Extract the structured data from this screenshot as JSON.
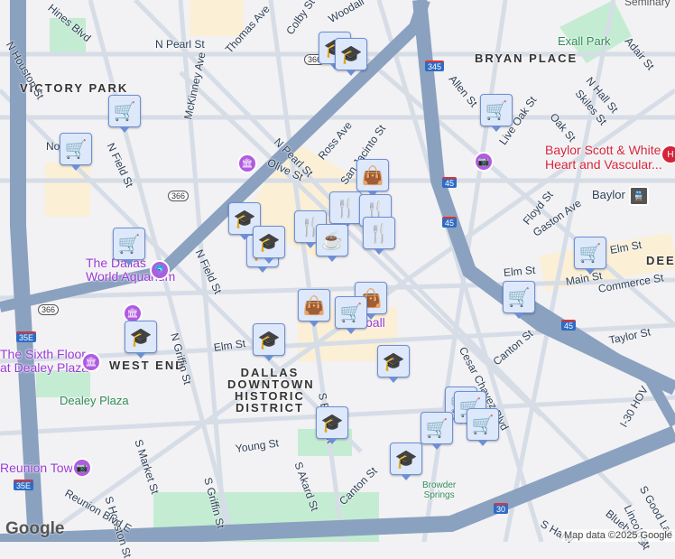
{
  "areas": {
    "victory_park": "VICTORY PARK",
    "bryan_place": "BRYAN PLACE",
    "west_end": "WEST END",
    "historic_1": "DALLAS",
    "historic_2": "DOWNTOWN",
    "historic_3": "HISTORIC",
    "historic_4": "DISTRICT",
    "deep": "DEEP",
    "seminary": "Seminary"
  },
  "parks": {
    "exall": "Exall Park",
    "dealey": "Dealey Plaza",
    "browder_1": "Browder",
    "browder_2": "Springs"
  },
  "pois": {
    "aquarium_1": "The Dallas",
    "aquarium_2": "World Aquarium",
    "sixth_floor_1": "The Sixth Floor",
    "sixth_floor_2": "at Dealey Plaza",
    "reunion": "Reunion Tower",
    "baylor_hosp_1": "Baylor Scott & White",
    "baylor_hosp_2": "Heart and Vascular...",
    "baylor_station": "Baylor",
    "poi_partial": "ball"
  },
  "streets": {
    "woodall": "Woodall",
    "n_pearl_1": "N Pearl St",
    "n_pearl_2": "N Pearl St",
    "thomas": "Thomas Ave",
    "colby": "Colby St",
    "mckinney": "McKinney Ave",
    "n_houston": "N Houston St",
    "n_field_1": "N Field St",
    "n_field_2": "N Field St",
    "olive": "Olive St",
    "ross": "Ross Ave",
    "san_jacinto": "San Jacinto St",
    "allen": "Allen St",
    "live_oak": "Live Oak St",
    "oak": "Oak St",
    "skiles": "Skiles St",
    "n_hall": "N Hall St",
    "adair": "Adair St",
    "floyd": "Floyd St",
    "gaston": "Gaston Ave",
    "elm_1": "Elm St",
    "elm_2": "Elm St",
    "elm_3": "Elm St",
    "main": "Main St",
    "commerce": "Commerce St",
    "taylor": "Taylor St",
    "canton_1": "Canton St",
    "canton_2": "Canton St",
    "cesar_chavez": "Cesar Chavez Blvd",
    "young": "Young St",
    "s_akard": "S Akard St",
    "s_ervay": "S Ervay St",
    "s_griffin": "S Griffin St",
    "n_griffin": "N Griffin St",
    "s_market": "S Market St",
    "s_houston": "S Houston St",
    "reunion_blvd": "Reunion Blvd E",
    "s_good_latimer": "S Good Lat",
    "lincoln": "Lincoln St",
    "bluebell": "Bluebell St",
    "s_harwood": "S Harw",
    "i30_hov": "I-30 HOV",
    "hines": "Hines Blvd",
    "north_partial": "No"
  },
  "shields": {
    "i345": "345",
    "i45_a": "45",
    "i45_b": "45",
    "i45_c": "45",
    "i35e_a": "35E",
    "i35e_b": "35E",
    "i30": "30",
    "sr366_a": "366",
    "sr366_b": "366",
    "sr366_c": "366"
  },
  "markers": [
    {
      "type": "education"
    },
    {
      "type": "education"
    },
    {
      "type": "grocery"
    },
    {
      "type": "grocery"
    },
    {
      "type": "grocery"
    },
    {
      "type": "shopping"
    },
    {
      "type": "education"
    },
    {
      "type": "education"
    },
    {
      "type": "grocery"
    },
    {
      "type": "restaurant"
    },
    {
      "type": "restaurant"
    },
    {
      "type": "restaurant"
    },
    {
      "type": "education"
    },
    {
      "type": "restaurant"
    },
    {
      "type": "cafe"
    },
    {
      "type": "shopping"
    },
    {
      "type": "shopping"
    },
    {
      "type": "grocery"
    },
    {
      "type": "grocery"
    },
    {
      "type": "grocery"
    },
    {
      "type": "education"
    },
    {
      "type": "education"
    },
    {
      "type": "education"
    },
    {
      "type": "grocery"
    },
    {
      "type": "grocery"
    },
    {
      "type": "grocery"
    },
    {
      "type": "grocery"
    },
    {
      "type": "education"
    },
    {
      "type": "education"
    }
  ],
  "icons": {
    "education": "🎓",
    "grocery": "🛒",
    "shopping": "👜",
    "restaurant": "🍴",
    "cafe": "☕"
  },
  "branding": {
    "logo": "Google",
    "attribution": "Map data ©2025 Google"
  }
}
